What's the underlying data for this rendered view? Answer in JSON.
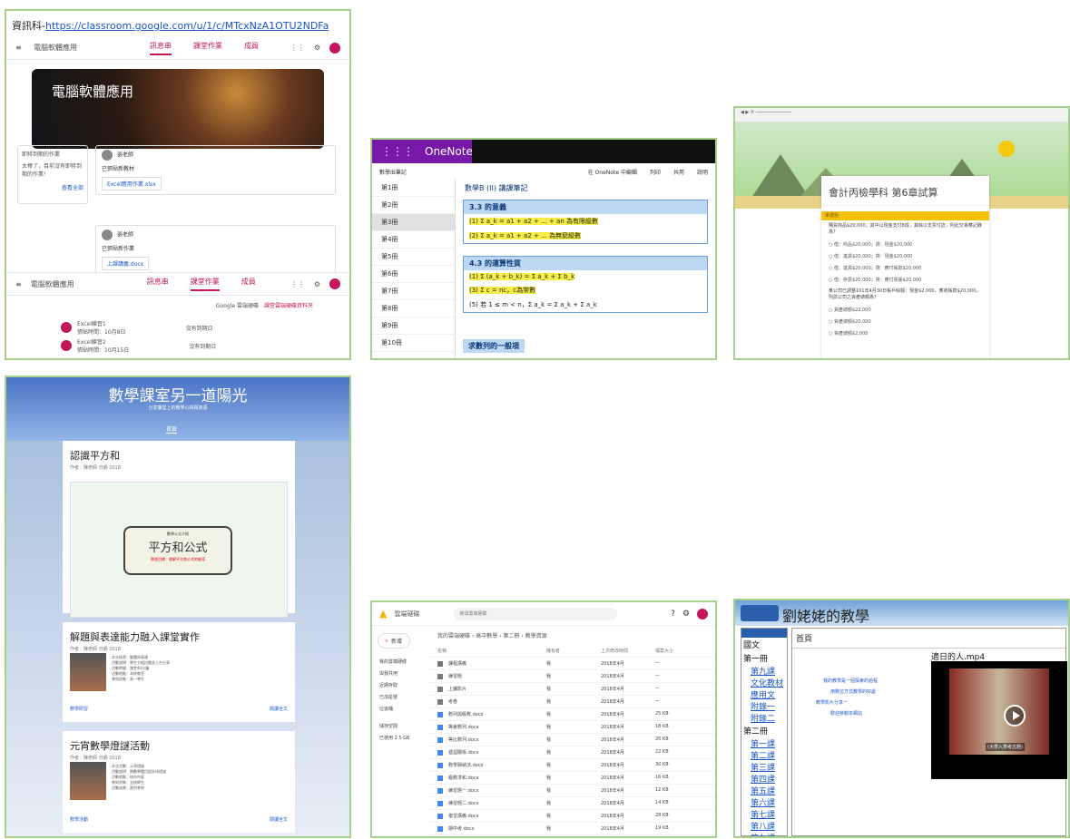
{
  "classroom": {
    "url_prefix": "資訊科-",
    "url": "https://classroom.google.com/u/1/c/MTcxNzA1OTU2NDFa",
    "class_name": "電腦軟體應用",
    "tabs": [
      "訊息串",
      "課堂作業",
      "成員"
    ],
    "banner_title": "電腦軟體應用",
    "upcoming_title": "即將到期的作業",
    "upcoming_text": "太棒了，目前沒有即將到期的作業！",
    "upcoming_link": "查看全部",
    "post1_author": "張老師",
    "post1_text": "已張貼新教材",
    "post1_attachment": "Excel應用作業.xlsx",
    "post2_author": "張老師",
    "post2_text": "已張貼新作業",
    "post2_attachment": "上課講義.docx",
    "work_link": "Google 雲端硬碟",
    "work_link2": "課堂雲端硬碟資料夾",
    "work_items": [
      {
        "title": "Excel練習1",
        "meta": "張貼時間：10月8日",
        "status": "沒有到期日"
      },
      {
        "title": "Excel練習2",
        "meta": "張貼時間：10月15日",
        "status": "沒有到期日"
      }
    ]
  },
  "onenote": {
    "app_title": "OneNote Online",
    "toolbar_edit": "在 OneNote 中編輯",
    "toolbar_print": "列印",
    "toolbar_share": "共用",
    "toolbar_help": "說明",
    "notebook": "數學IB筆記",
    "breadcrumb": "數學B (II) 講課筆記",
    "pages": [
      "第1冊",
      "第2冊",
      "第3冊",
      "第4冊",
      "第5冊",
      "第6冊",
      "第7冊",
      "第8冊",
      "第9冊",
      "第10冊"
    ],
    "section1_title": "3.3 的意義",
    "section1_line1": "(1) Σ a_k = a1 + a2 + ... + an 為有限級數",
    "section1_line2": "(2) Σ a_k = a1 + a2 + ... 為無窮級數",
    "section2_title": "4.3 的運算性質",
    "section2_line1": "(1) Σ (a_k + b_k) = Σ a_k + Σ b_k",
    "section2_line2": "(3) Σ c = nc，c為常數",
    "section2_line3": "(5) 若 1 ≤ m < n，Σ a_k = Σ a_k + Σ a_k",
    "section3_title": "求數列的一般項"
  },
  "quiz": {
    "title": "會計丙檢學科 第6章試算",
    "band": "單選題",
    "question1": "購買商品$20,000，其中以現金支付8成，其餘以支票付訖，則此交易應記錄為？",
    "options1": [
      "借：商品$20,000；貸：現金$20,000",
      "借：進貨$20,000；貸：現金$20,000",
      "借：進貨$20,000；貸：應付帳款$20,000",
      "借：存貨$20,000；貸：應付票據$20,000"
    ],
    "question2": "某公司已調整101年4月30日帳戶餘額：現金$2,000，應收帳款$20,000，則該公司之資產總額為？",
    "options2": [
      "資產總額$22,000",
      "資產總額$20,000",
      "資產總額$2,000"
    ]
  },
  "blog": {
    "site_title": "數學課室另一道陽光",
    "site_subtitle": "分享課堂上的教學心得與資源",
    "home_tab": "首頁",
    "posts": [
      {
        "title": "認識平方和",
        "meta": "作者：陳老師 日期 2018",
        "bubble_top": "數學公式介紹",
        "bubble_main": "平方和公式",
        "bubble_sub": "學習目標：理解平方和公式的推導",
        "more": "繼續閱讀",
        "footer_right": "閱讀全文"
      },
      {
        "title": "解題與表達能力融入課堂實作",
        "meta": "作者：陳老師 日期 2018",
        "lines": [
          "本次研習：解題與表達",
          "活動說明：學生分組討論並上台分享",
          "活動時間：課堂40分鐘",
          "活動地點：本校教室",
          "參與對象：高一學生"
        ],
        "label": "數學研習",
        "footer_right": "閱讀全文"
      },
      {
        "title": "元宵數學燈謎活動",
        "meta": "作者：陳老師 日期 2018",
        "lines": [
          "本次活動：元宵燈謎",
          "活動說明：將數學題目設計成燈謎",
          "活動地點：校內中庭",
          "參與對象：全校師生",
          "活動成果：熱烈參與"
        ],
        "label": "數學活動",
        "footer_right": "閱讀全文"
      }
    ]
  },
  "drive": {
    "app_title": "雲端硬碟",
    "search_placeholder": "搜尋雲端硬碟",
    "new_button": "新增",
    "side_items": [
      "我的雲端硬碟",
      "與我共用",
      "近期存取",
      "已加星號",
      "垃圾桶",
      "儲存空間"
    ],
    "storage": "已使用 2.5 GB",
    "breadcrumb": "我的雲端硬碟 › 高中數學 › 第二冊 › 教學資源",
    "col_name": "名稱",
    "col_owner": "擁有者",
    "col_modified": "上次修改時間",
    "col_size": "檔案大小",
    "rows": [
      {
        "name": "課程講義",
        "owner": "我",
        "date": "2018年4月",
        "size": "—",
        "folder": true
      },
      {
        "name": "練習題",
        "owner": "我",
        "date": "2018年4月",
        "size": "—",
        "folder": true
      },
      {
        "name": "上課影片",
        "owner": "我",
        "date": "2018年4月",
        "size": "—",
        "folder": true
      },
      {
        "name": "考卷",
        "owner": "我",
        "date": "2018年4月",
        "size": "—",
        "folder": true
      },
      {
        "name": "數列與級數.docx",
        "owner": "我",
        "date": "2018年4月",
        "size": "25 KB",
        "folder": false
      },
      {
        "name": "等差數列.docx",
        "owner": "我",
        "date": "2018年4月",
        "size": "18 KB",
        "folder": false
      },
      {
        "name": "等比數列.docx",
        "owner": "我",
        "date": "2018年4月",
        "size": "20 KB",
        "folder": false
      },
      {
        "name": "遞迴關係.docx",
        "owner": "我",
        "date": "2018年4月",
        "size": "22 KB",
        "folder": false
      },
      {
        "name": "數學歸納法.docx",
        "owner": "我",
        "date": "2018年4月",
        "size": "30 KB",
        "folder": false
      },
      {
        "name": "級數求和.docx",
        "owner": "我",
        "date": "2018年4月",
        "size": "16 KB",
        "folder": false
      },
      {
        "name": "練習題一.docx",
        "owner": "我",
        "date": "2018年4月",
        "size": "12 KB",
        "folder": false
      },
      {
        "name": "練習題二.docx",
        "owner": "我",
        "date": "2018年4月",
        "size": "14 KB",
        "folder": false
      },
      {
        "name": "複習講義.docx",
        "owner": "我",
        "date": "2018年4月",
        "size": "28 KB",
        "folder": false
      },
      {
        "name": "期中考.docx",
        "owner": "我",
        "date": "2018年4月",
        "size": "19 KB",
        "folder": false
      },
      {
        "name": "期末考.docx",
        "owner": "我",
        "date": "2018年4月",
        "size": "21 KB",
        "folder": false
      }
    ]
  },
  "video": {
    "site_title": "劉姥姥的教學",
    "home": "首頁",
    "nav": [
      {
        "text": "國文",
        "type": "h"
      },
      {
        "text": "第一冊",
        "type": "h"
      },
      {
        "text": "第九課",
        "type": "i"
      },
      {
        "text": "文化教材",
        "type": "i"
      },
      {
        "text": "應用文",
        "type": "i"
      },
      {
        "text": "附錄一",
        "type": "i"
      },
      {
        "text": "附錄二",
        "type": "i"
      },
      {
        "text": "第二冊",
        "type": "h"
      },
      {
        "text": "第一課",
        "type": "i"
      },
      {
        "text": "第二課",
        "type": "i"
      },
      {
        "text": "第三課",
        "type": "i"
      },
      {
        "text": "第四課",
        "type": "i"
      },
      {
        "text": "第五課",
        "type": "i"
      },
      {
        "text": "第六課",
        "type": "i"
      },
      {
        "text": "第七課",
        "type": "i"
      },
      {
        "text": "第八課",
        "type": "i"
      },
      {
        "text": "第九課",
        "type": "i"
      }
    ],
    "links": [
      "我的教學是一個探索的過程",
      "用數位方式教學的好處",
      "教學影片分享一",
      "歡迎參觀本網站"
    ],
    "video_title": "適日的人.mp4",
    "caption": "(大學入學考古題)"
  }
}
